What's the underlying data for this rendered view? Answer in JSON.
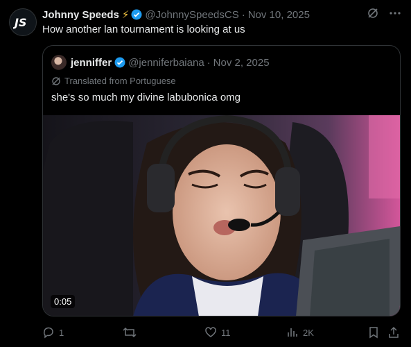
{
  "tweet": {
    "author_name": "Johnny Speeds",
    "author_emoji": "⚡",
    "handle": "@JohnnySpeedsCS",
    "separator": "·",
    "date": "Nov 10, 2025",
    "text": "How another lan tournament is looking at us",
    "avatar_logo": "JS"
  },
  "quote": {
    "author_name": "jenniffer",
    "handle": "@jenniferbaiana",
    "separator": "·",
    "date": "Nov 2, 2025",
    "translated_label": "Translated from Portuguese",
    "text": "she's so much my divine labubonica omg",
    "video_duration": "0:05"
  },
  "actions": {
    "replies": "1",
    "reposts": "",
    "likes": "11",
    "views": "2K"
  },
  "colors": {
    "verified": "#1d9bf0",
    "muted": "#71767b",
    "text": "#e7e9ea",
    "border": "#2f3336"
  }
}
